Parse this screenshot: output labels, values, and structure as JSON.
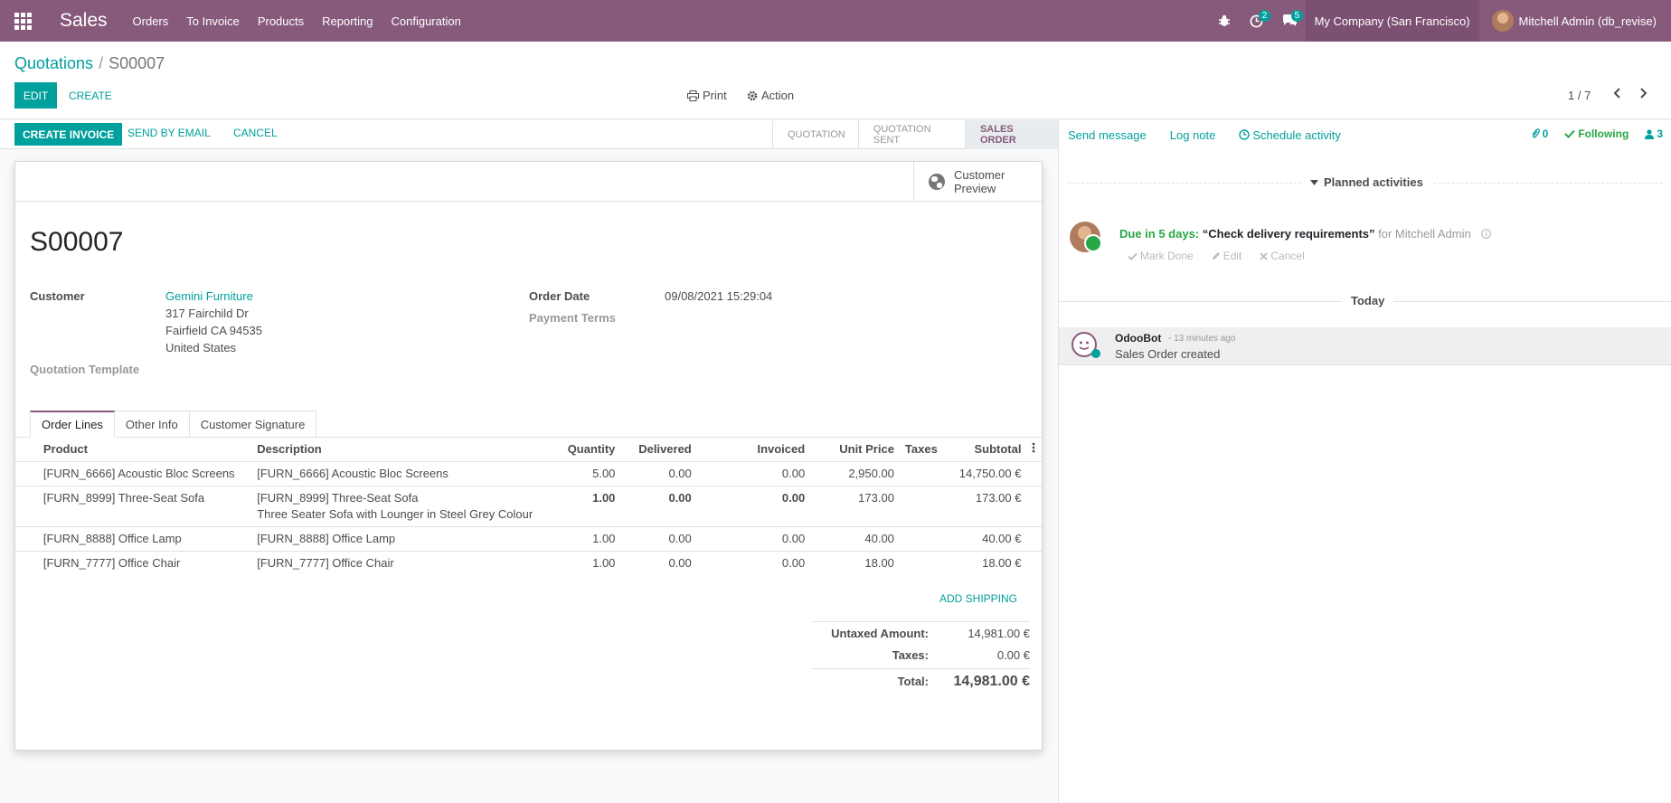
{
  "nav": {
    "app_title": "Sales",
    "menu": [
      "Orders",
      "To Invoice",
      "Products",
      "Reporting",
      "Configuration"
    ],
    "activity_count": "2",
    "message_count": "5",
    "company": "My Company (San Francisco)",
    "user": "Mitchell Admin (db_revise)"
  },
  "breadcrumb": {
    "parent": "Quotations",
    "current": "S00007"
  },
  "control": {
    "edit_label": "EDIT",
    "create_label": "CREATE",
    "print_label": "Print",
    "action_label": "Action",
    "pager": "1 / 7"
  },
  "statusbar": {
    "create_invoice": "CREATE INVOICE",
    "send_email": "SEND BY EMAIL",
    "cancel": "CANCEL",
    "stages": [
      "QUOTATION",
      "QUOTATION SENT",
      "SALES ORDER"
    ],
    "active_stage": "SALES ORDER"
  },
  "form": {
    "customer_preview": "Customer Preview",
    "name": "S00007",
    "customer_label": "Customer",
    "customer_name": "Gemini Furniture",
    "address": [
      "317 Fairchild Dr",
      "Fairfield CA 94535",
      "United States"
    ],
    "quotation_template_label": "Quotation Template",
    "order_date_label": "Order Date",
    "order_date": "09/08/2021 15:29:04",
    "payment_terms_label": "Payment Terms",
    "tabs": [
      "Order Lines",
      "Other Info",
      "Customer Signature"
    ]
  },
  "lines": {
    "headers": [
      "Product",
      "Description",
      "Quantity",
      "Delivered",
      "Invoiced",
      "Unit Price",
      "Taxes",
      "Subtotal"
    ],
    "rows": [
      {
        "product": "[FURN_6666] Acoustic Bloc Screens",
        "description": "[FURN_6666] Acoustic Bloc Screens",
        "description2": "",
        "quantity": "5.00",
        "delivered": "0.00",
        "invoiced": "0.00",
        "unit_price": "2,950.00",
        "taxes": "",
        "subtotal": "14,750.00 €"
      },
      {
        "product": "[FURN_8999] Three-Seat Sofa",
        "description": "[FURN_8999] Three-Seat Sofa",
        "description2": "Three Seater Sofa with Lounger in Steel Grey Colour",
        "quantity": "1.00",
        "delivered": "0.00",
        "invoiced": "0.00",
        "unit_price": "173.00",
        "taxes": "",
        "subtotal": "173.00 €"
      },
      {
        "product": "[FURN_8888] Office Lamp",
        "description": "[FURN_8888] Office Lamp",
        "description2": "",
        "quantity": "1.00",
        "delivered": "0.00",
        "invoiced": "0.00",
        "unit_price": "40.00",
        "taxes": "",
        "subtotal": "40.00 €"
      },
      {
        "product": "[FURN_7777] Office Chair",
        "description": "[FURN_7777] Office Chair",
        "description2": "",
        "quantity": "1.00",
        "delivered": "0.00",
        "invoiced": "0.00",
        "unit_price": "18.00",
        "taxes": "",
        "subtotal": "18.00 €"
      }
    ],
    "add_shipping": "ADD SHIPPING"
  },
  "totals": {
    "untaxed_label": "Untaxed Amount:",
    "untaxed": "14,981.00 €",
    "taxes_label": "Taxes:",
    "taxes": "0.00 €",
    "total_label": "Total:",
    "total": "14,981.00 €"
  },
  "chatter": {
    "send_message": "Send message",
    "log_note": "Log note",
    "schedule_activity": "Schedule activity",
    "attachments": "0",
    "following": "Following",
    "followers": "3",
    "planned_label": "Planned activities",
    "activity": {
      "due": "Due in 5 days:",
      "title": "“Check delivery requirements”",
      "for": "for Mitchell Admin",
      "mark_done": "Mark Done",
      "edit": "Edit",
      "cancel": "Cancel"
    },
    "today_label": "Today",
    "message": {
      "author": "OdooBot",
      "time": "- 13 minutes ago",
      "body": "Sales Order created"
    }
  }
}
